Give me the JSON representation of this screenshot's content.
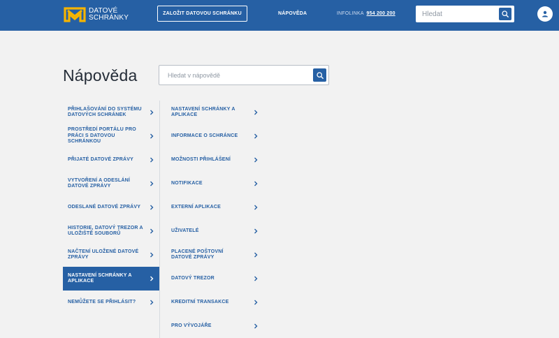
{
  "header": {
    "logo_line1": "DATOVÉ",
    "logo_line2": "SCHRÁNKY",
    "create_button": "ZALOŽIT DATOVOU SCHRÁNKU",
    "help_link": "NÁPOVĚDA",
    "infoline_label": "INFOLINKA",
    "infoline_number": "954 200 200",
    "search_placeholder": "Hledat",
    "brand_color": "#2660a4",
    "logo_color": "#f5b400"
  },
  "main": {
    "title": "Nápověda",
    "search_placeholder": "Hledat v nápovědě"
  },
  "left_menu": [
    {
      "label": "PŘIHLAŠOVÁNÍ DO SYSTÉMU DATOVÝCH SCHRÁNEK",
      "active": false
    },
    {
      "label": "PROSTŘEDÍ PORTÁLU PRO PRÁCI S DATOVOU SCHRÁNKOU",
      "active": false
    },
    {
      "label": "PŘIJATÉ DATOVÉ ZPRÁVY",
      "active": false
    },
    {
      "label": "VYTVOŘENÍ A ODESLÁNÍ DATOVÉ ZPRÁVY",
      "active": false
    },
    {
      "label": "ODESLANÉ DATOVÉ ZPRÁVY",
      "active": false
    },
    {
      "label": "HISTORIE, DATOVÝ TREZOR A ULOŽIŠTĚ SOUBORŮ",
      "active": false
    },
    {
      "label": "NAČTENÍ ULOŽENÉ DATOVÉ ZPRÁVY",
      "active": false
    },
    {
      "label": "NASTAVENÍ SCHRÁNKY A APLIKACE",
      "active": true
    },
    {
      "label": "NEMŮŽETE SE PŘIHLÁSIT?",
      "active": false
    }
  ],
  "right_menu": [
    {
      "label": "NASTAVENÍ SCHRÁNKY A APLIKACE"
    },
    {
      "label": "INFORMACE O SCHRÁNCE"
    },
    {
      "label": "MOŽNOSTI PŘIHLÁŠENÍ"
    },
    {
      "label": "NOTIFIKACE"
    },
    {
      "label": "EXTERNÍ APLIKACE"
    },
    {
      "label": "UŽIVATELÉ"
    },
    {
      "label": "PLACENÉ POŠTOVNÍ DATOVÉ ZPRÁVY"
    },
    {
      "label": "DATOVÝ TREZOR"
    },
    {
      "label": "KREDITNÍ TRANSAKCE"
    },
    {
      "label": "PRO VÝVOJÁŘE"
    }
  ],
  "icons": {
    "logo": "datove-schranky-logo-icon",
    "search": "search-icon",
    "avatar": "user-icon",
    "chevron": "chevron-right-icon"
  }
}
